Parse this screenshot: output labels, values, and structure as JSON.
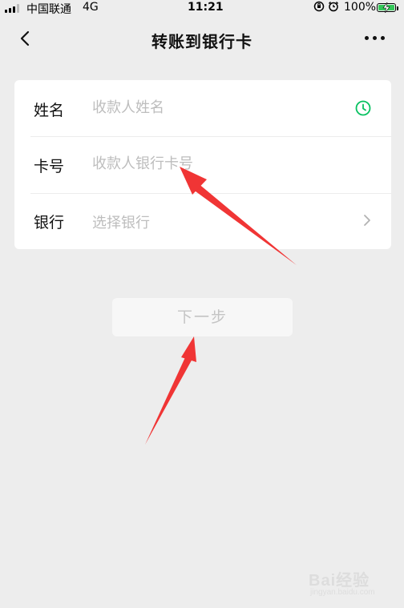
{
  "status_bar": {
    "carrier": "中国联通",
    "network": "4G",
    "time": "11:21",
    "battery": "100%",
    "icons": [
      "orientation-lock-icon",
      "alarm-icon",
      "battery-charging-icon",
      "signal-icon"
    ]
  },
  "nav": {
    "title": "转账到银行卡"
  },
  "form": {
    "name": {
      "label": "姓名",
      "placeholder": "收款人姓名"
    },
    "card": {
      "label": "卡号",
      "placeholder": "收款人银行卡号"
    },
    "bank": {
      "label": "银行",
      "placeholder": "选择银行"
    }
  },
  "next_button": {
    "label": "下一步"
  },
  "colors": {
    "background": "#ededed",
    "card": "#ffffff",
    "accent_green": "#07c160",
    "annotation_red": "#f03535",
    "placeholder": "#bdbdbd"
  },
  "watermark": {
    "text": "Bai经验",
    "sub": "jingyan.baidu.com"
  }
}
